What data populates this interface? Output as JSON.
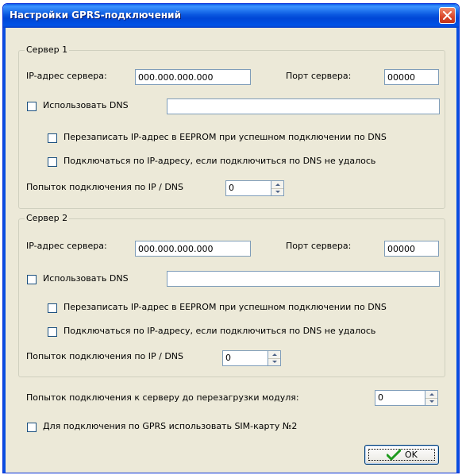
{
  "window": {
    "title": "Настройки GPRS-подключений"
  },
  "server1": {
    "legend": "Сервер 1",
    "ip_label": "IP-адрес сервера:",
    "ip_value": "000.000.000.000",
    "port_label": "Порт сервера:",
    "port_value": "00000",
    "use_dns_label": "Использовать DNS",
    "use_dns_checked": false,
    "dns_value": "",
    "rewrite_label": "Перезаписать IP-адрес в EEPROM при успешном подключении по DNS",
    "rewrite_checked": false,
    "fallback_label": "Подключаться по IP-адресу, если подключиться по DNS не удалось",
    "fallback_checked": false,
    "attempts_label": "Попыток подключения по IP / DNS",
    "attempts_value": "0"
  },
  "server2": {
    "legend": "Сервер 2",
    "ip_label": "IP-адрес сервера:",
    "ip_value": "000.000.000.000",
    "port_label": "Порт сервера:",
    "port_value": "00000",
    "use_dns_label": "Использовать DNS",
    "use_dns_checked": false,
    "dns_value": "",
    "rewrite_label": "Перезаписать IP-адрес в EEPROM при успешном подключении по DNS",
    "rewrite_checked": false,
    "fallback_label": "Подключаться по IP-адресу, если подключиться по DNS не удалось",
    "fallback_checked": false,
    "attempts_label": "Попыток подключения по IP / DNS",
    "attempts_value": "0"
  },
  "reboot_attempts_label": "Попыток подключения к серверу до перезагрузки модуля:",
  "reboot_attempts_value": "0",
  "sim2_label": "Для подключения по GPRS использовать SIM-карту №2",
  "sim2_checked": false,
  "ok_button": {
    "label": "OK",
    "icon": "checkmark-icon",
    "icon_color": "#1e9a1e"
  },
  "colors": {
    "titlebar": "#0a58e0",
    "dialog_bg": "#ece9d8",
    "close_button": "#d9462a"
  }
}
